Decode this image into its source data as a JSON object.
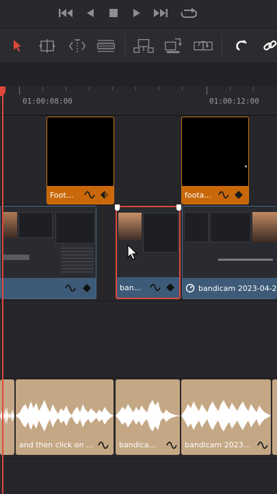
{
  "transport": {
    "buttons": [
      {
        "name": "skip-to-start-button",
        "icon": "skip-to-start-icon"
      },
      {
        "name": "step-back-button",
        "icon": "play-reverse-icon"
      },
      {
        "name": "stop-button",
        "icon": "stop-icon"
      },
      {
        "name": "play-button",
        "icon": "play-icon"
      },
      {
        "name": "skip-to-end-button",
        "icon": "skip-to-end-icon"
      },
      {
        "name": "loop-button",
        "icon": "loop-icon"
      }
    ]
  },
  "toolbar": {
    "tools": [
      {
        "name": "selection-tool",
        "icon": "arrow-pointer-icon",
        "active": true
      },
      {
        "name": "trim-edit-tool",
        "icon": "trim-icon"
      },
      {
        "name": "dynamic-trim-tool",
        "icon": "dynamic-trim-icon"
      },
      {
        "name": "blade-tool",
        "icon": "blade-icon"
      },
      {
        "name": "insert-clip-button",
        "icon": "insert-clip-icon"
      },
      {
        "name": "overwrite-clip-button",
        "icon": "overwrite-clip-icon"
      },
      {
        "name": "replace-clip-button",
        "icon": "replace-clip-icon"
      },
      {
        "name": "snapping-toggle",
        "icon": "magnet-icon"
      },
      {
        "name": "linked-selection-toggle",
        "icon": "chain-link-icon"
      }
    ],
    "accent_color": "#e0483c"
  },
  "ruler": {
    "timecodes": [
      "01:00:08:00",
      "01:00:12:00"
    ]
  },
  "tracks": {
    "video_upper": [
      {
        "label": "Foot...",
        "color": "#c9680a"
      },
      {
        "label": "foota...",
        "color": "#c9680a"
      }
    ],
    "video_lower": [
      {
        "label": "",
        "color": "#3d5b78"
      },
      {
        "label": "ban...",
        "color": "#2b4660",
        "selected": true
      },
      {
        "label": "bandicam 2023-04-2",
        "color": "#3d5b78",
        "retimed": true
      }
    ],
    "audio": [
      {
        "label": ""
      },
      {
        "label": "and then click on ..."
      },
      {
        "label": "bandica..."
      },
      {
        "label": "bandicam 2023..."
      },
      {
        "label": ""
      }
    ],
    "audio_color": "#c4a784",
    "playhead_color": "#e0483c"
  }
}
